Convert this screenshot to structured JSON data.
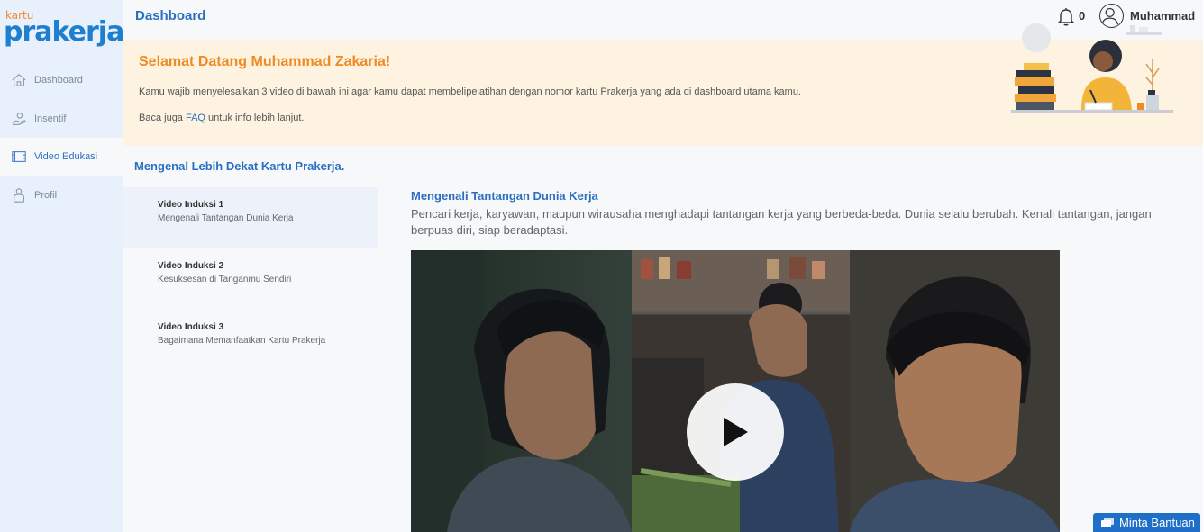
{
  "app": {
    "logo_top": "kartu",
    "logo_main": "prakerja"
  },
  "sidebar": {
    "items": [
      {
        "label": "Dashboard",
        "icon": "home-icon"
      },
      {
        "label": "Insentif",
        "icon": "hand-coin-icon"
      },
      {
        "label": "Video Edukasi",
        "icon": "film-icon"
      },
      {
        "label": "Profil",
        "icon": "person-icon"
      }
    ],
    "active": "Video Edukasi"
  },
  "header": {
    "title": "Dashboard",
    "notification_count": "0",
    "user_name": "Muhammad"
  },
  "banner": {
    "greeting": "Selamat Datang Muhammad Zakaria!",
    "message": "Kamu wajib menyelesaikan 3 video di bawah ini agar kamu dapat membelipelatihan dengan nomor kartu Prakerja yang ada di dashboard utama kamu.",
    "faq_prefix": "Baca juga ",
    "faq_link": "FAQ",
    "faq_suffix": " untuk info lebih lanjut."
  },
  "section_title": "Mengenal Lebih Dekat Kartu Prakerja.",
  "videos": [
    {
      "title": "Video Induksi 1",
      "subtitle": "Mengenali Tantangan Dunia Kerja"
    },
    {
      "title": "Video Induksi 2",
      "subtitle": "Kesuksesan di Tanganmu Sendiri"
    },
    {
      "title": "Video Induksi 3",
      "subtitle": "Bagaimana Memanfaatkan Kartu Prakerja"
    }
  ],
  "selected_video": {
    "title": "Mengenali Tantangan Dunia Kerja",
    "description": "Pencari kerja, karyawan, maupun wirausaha menghadapi tantangan kerja yang berbeda-beda. Dunia selalu berubah. Kenali tantangan, jangan berpuas diri, siap beradaptasi."
  },
  "help_button": "Minta Bantuan",
  "colors": {
    "primary": "#2a6fc1",
    "accent": "#f08a22",
    "sidebar_bg": "#e8f0fb",
    "banner_bg": "#fdf3e0"
  }
}
